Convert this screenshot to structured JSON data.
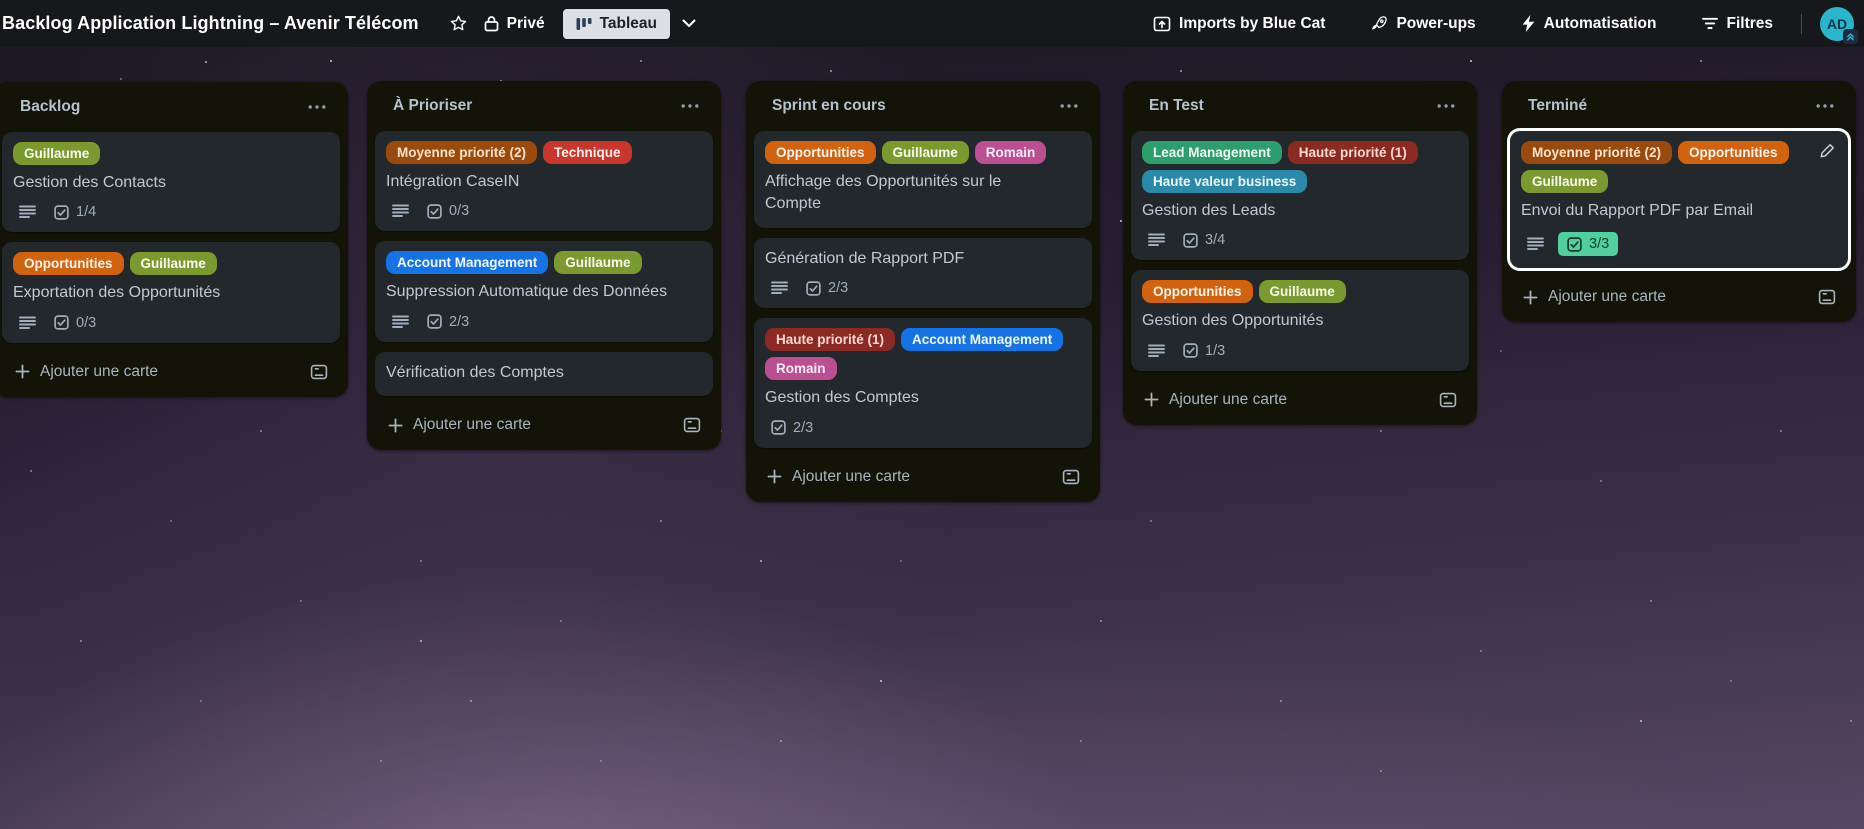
{
  "header": {
    "board_title": "Backlog Application Lightning – Avenir Télécom",
    "privacy": {
      "label": "Privé"
    },
    "view_switcher": {
      "label": "Tableau"
    },
    "nav_items": [
      {
        "icon": "import-icon",
        "label": "Imports by Blue Cat"
      },
      {
        "icon": "rocket-icon",
        "label": "Power-ups"
      },
      {
        "icon": "lightning-icon",
        "label": "Automatisation"
      },
      {
        "icon": "filter-icon",
        "label": "Filtres"
      }
    ],
    "avatar_initials": "AD"
  },
  "colors": {
    "done_badge_bg": "#4fd09c",
    "done_badge_fg": "#173b2d",
    "avatar_bg": "#29b6cc",
    "avatar_fg": "#10364a"
  },
  "icons": {
    "star": "star-outline",
    "lock": "padlock",
    "board_view": "three-bars",
    "chevron_down": "chevron-down",
    "list_menu": "ellipsis",
    "plus": "plus",
    "description": "text-lines",
    "checklist": "checked-box",
    "card_template": "template-card",
    "pencil": "edit-pencil",
    "avatar_badge": "double-chevron-up"
  },
  "board": {
    "add_card_label": "Ajouter une carte",
    "lists": [
      {
        "title": "Backlog",
        "cards": [
          {
            "labels": [
              {
                "text": "Guillaume",
                "bg": "#7a9a2f",
                "fg": "#f8fcef"
              }
            ],
            "title": "Gestion des Contacts",
            "checklist": "1/4"
          },
          {
            "labels": [
              {
                "text": "Opportunities",
                "bg": "#d1620e",
                "fg": "#fff7ef"
              },
              {
                "text": "Guillaume",
                "bg": "#7a9a2f",
                "fg": "#f8fcef"
              }
            ],
            "title": "Exportation des Opportunités",
            "checklist": "0/3"
          }
        ]
      },
      {
        "title": "À Prioriser",
        "cards": [
          {
            "labels": [
              {
                "text": "Moyenne priorité (2)",
                "bg": "#9b4a0d",
                "fg": "#ffe3cd"
              },
              {
                "text": "Technique",
                "bg": "#c9372c",
                "fg": "#ffefed"
              }
            ],
            "title": "Intégration CaseIN",
            "checklist": "0/3"
          },
          {
            "labels": [
              {
                "text": "Account Management",
                "bg": "#1673e6",
                "fg": "#f2f7ff"
              },
              {
                "text": "Guillaume",
                "bg": "#7a9a2f",
                "fg": "#f8fcef"
              }
            ],
            "title": "Suppression Automatique des Données",
            "checklist": "2/3"
          },
          {
            "labels": [],
            "title": "Vérification des Comptes",
            "checklist": null
          }
        ]
      },
      {
        "title": "Sprint en cours",
        "cards": [
          {
            "labels": [
              {
                "text": "Opportunities",
                "bg": "#d1620e",
                "fg": "#fff7ef"
              },
              {
                "text": "Guillaume",
                "bg": "#7a9a2f",
                "fg": "#f8fcef"
              },
              {
                "text": "Romain",
                "bg": "#bb4f91",
                "fg": "#ffeefa"
              }
            ],
            "title": "Affichage des Opportunités sur le Compte",
            "checklist": null
          },
          {
            "labels": [],
            "title": "Génération de Rapport PDF",
            "checklist": "2/3"
          },
          {
            "labels": [
              {
                "text": "Haute priorité (1)",
                "bg": "#8a2a22",
                "fg": "#ffd9d4"
              },
              {
                "text": "Account Management",
                "bg": "#1673e6",
                "fg": "#f2f7ff"
              },
              {
                "text": "Romain",
                "bg": "#bb4f91",
                "fg": "#ffeefa"
              }
            ],
            "title": "Gestion des Comptes",
            "checklist": "2/3"
          }
        ]
      },
      {
        "title": "En Test",
        "cards": [
          {
            "labels": [
              {
                "text": "Lead Management",
                "bg": "#2e9e6d",
                "fg": "#ecfdf4"
              },
              {
                "text": "Haute priorité (1)",
                "bg": "#8a2a22",
                "fg": "#ffd9d4"
              },
              {
                "text": "Haute valeur business",
                "bg": "#2b89aa",
                "fg": "#edfaff"
              }
            ],
            "title": "Gestion des Leads",
            "checklist": "3/4"
          },
          {
            "labels": [
              {
                "text": "Opportunities",
                "bg": "#d1620e",
                "fg": "#fff7ef"
              },
              {
                "text": "Guillaume",
                "bg": "#7a9a2f",
                "fg": "#f8fcef"
              }
            ],
            "title": "Gestion des Opportunités",
            "checklist": "1/3"
          }
        ]
      },
      {
        "title": "Terminé",
        "cards": [
          {
            "labels": [
              {
                "text": "Moyenne priorité (2)",
                "bg": "#9b4a0d",
                "fg": "#ffe3cd"
              },
              {
                "text": "Opportunities",
                "bg": "#d1620e",
                "fg": "#fff7ef"
              },
              {
                "text": "Guillaume",
                "bg": "#7a9a2f",
                "fg": "#f8fcef"
              }
            ],
            "title": "Envoi du Rapport PDF par Email",
            "checklist": "3/3",
            "checklist_done": true
          }
        ]
      }
    ]
  }
}
